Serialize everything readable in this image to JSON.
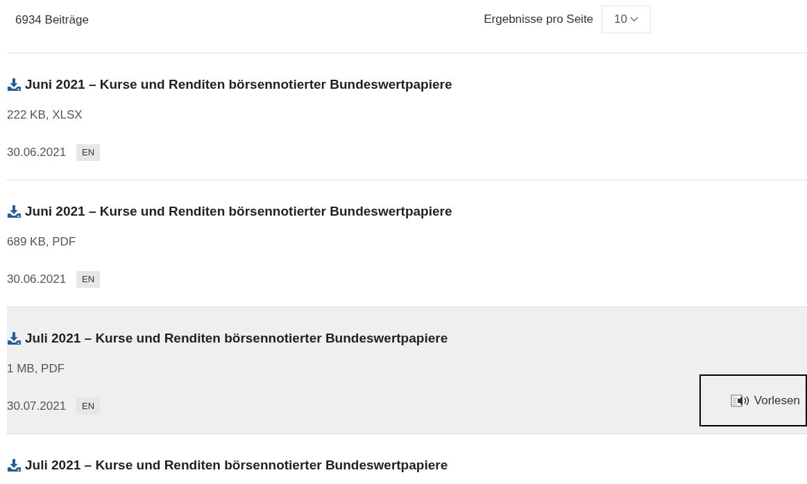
{
  "results_count": "6934 Beiträge",
  "per_page": {
    "label": "Ergebnisse pro Seite",
    "value": "10"
  },
  "items": [
    {
      "title": "Juni 2021 – Kurse und Renditen börsennotierter Bundeswertpapiere",
      "meta": "222 KB, XLSX",
      "date": "30.06.2021",
      "language": "EN",
      "highlighted": false
    },
    {
      "title": "Juni 2021 – Kurse und Renditen börsennotierter Bundeswertpapiere",
      "meta": "689 KB, PDF",
      "date": "30.06.2021",
      "language": "EN",
      "highlighted": false
    },
    {
      "title": "Juli 2021 – Kurse und Renditen börsennotierter Bundeswertpapiere",
      "meta": "1 MB, PDF",
      "date": "30.07.2021",
      "language": "EN",
      "highlighted": true,
      "read_aloud": "Vorlesen"
    },
    {
      "title": "Juli 2021 – Kurse und Renditen börsennotierter Bundeswertpapiere",
      "highlighted": false
    }
  ]
}
